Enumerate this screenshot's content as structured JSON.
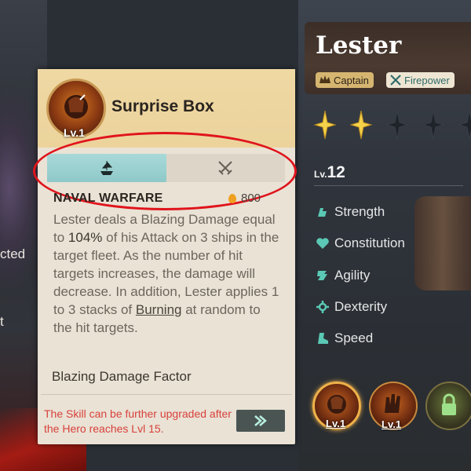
{
  "background": {
    "left_partial_texts": [
      "cted",
      "t"
    ]
  },
  "hero": {
    "name": "Lester",
    "tags": [
      {
        "label": "Captain",
        "icon": "captain-icon"
      },
      {
        "label": "Firepower",
        "icon": "crossed-swords-icon"
      }
    ],
    "stars_filled": 2,
    "stars_total": 5,
    "level_prefix": "Lv.",
    "level": "12",
    "attributes": [
      {
        "label": "Strength",
        "icon": "strength-icon"
      },
      {
        "label": "Constitution",
        "icon": "heart-icon"
      },
      {
        "label": "Agility",
        "icon": "agility-icon"
      },
      {
        "label": "Dexterity",
        "icon": "crosshair-icon"
      },
      {
        "label": "Speed",
        "icon": "boot-icon"
      }
    ],
    "skills": [
      {
        "level": "Lv.1",
        "selected": true
      },
      {
        "level": "Lv.1",
        "selected": false
      },
      {
        "level": "",
        "locked": true
      }
    ]
  },
  "skill_panel": {
    "badge_level": "Lv.1",
    "title": "Surprise Box",
    "tabs": [
      {
        "name": "naval",
        "icon": "ship-icon",
        "active": true
      },
      {
        "name": "land",
        "icon": "crossed-swords-icon",
        "active": false
      }
    ],
    "section_title": "NAVAL WARFARE",
    "cost": "800",
    "description": {
      "part1": "Lester deals a Blazing Damage equal to ",
      "highlight": "104%",
      "part2": " of his Attack on 3 ships in the target fleet. As the number of hit targets increases, the damage will decrease. In addition, Lester applies 1 to 3 stacks of ",
      "link": "Burning",
      "part3": " at random to the hit targets."
    },
    "factor_label": "Blazing Damage Factor",
    "upgrade_note": "The Skill can be further upgraded after the Hero reaches Lvl 15."
  },
  "colors": {
    "panel_bg": "#e9e2d5",
    "panel_header": "#ecd39c",
    "active_tab": "#a9d9d9",
    "warning_text": "#d9413c",
    "highlight_oval": "#e0141c",
    "gold_star": "#f4d24a"
  }
}
